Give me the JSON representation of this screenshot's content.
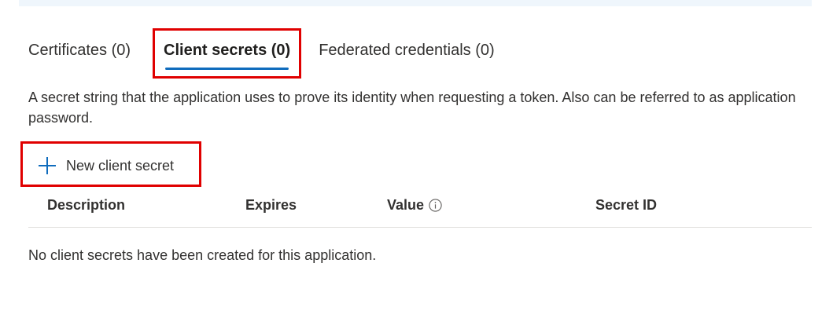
{
  "tabs": [
    {
      "label": "Certificates (0)",
      "active": false
    },
    {
      "label": "Client secrets (0)",
      "active": true
    },
    {
      "label": "Federated credentials (0)",
      "active": false
    }
  ],
  "description": "A secret string that the application uses to prove its identity when requesting a token. Also can be referred to as application password.",
  "toolbar": {
    "new_secret_label": "New client secret",
    "new_secret_icon": "plus-icon"
  },
  "table": {
    "columns": [
      "Description",
      "Expires",
      "Value",
      "Secret ID"
    ],
    "value_info_icon": "info-icon",
    "empty_message": "No client secrets have been created for this application."
  },
  "colors": {
    "highlight_box": "#e00000",
    "accent": "#0f6cbd",
    "banner": "#eff6fc"
  }
}
